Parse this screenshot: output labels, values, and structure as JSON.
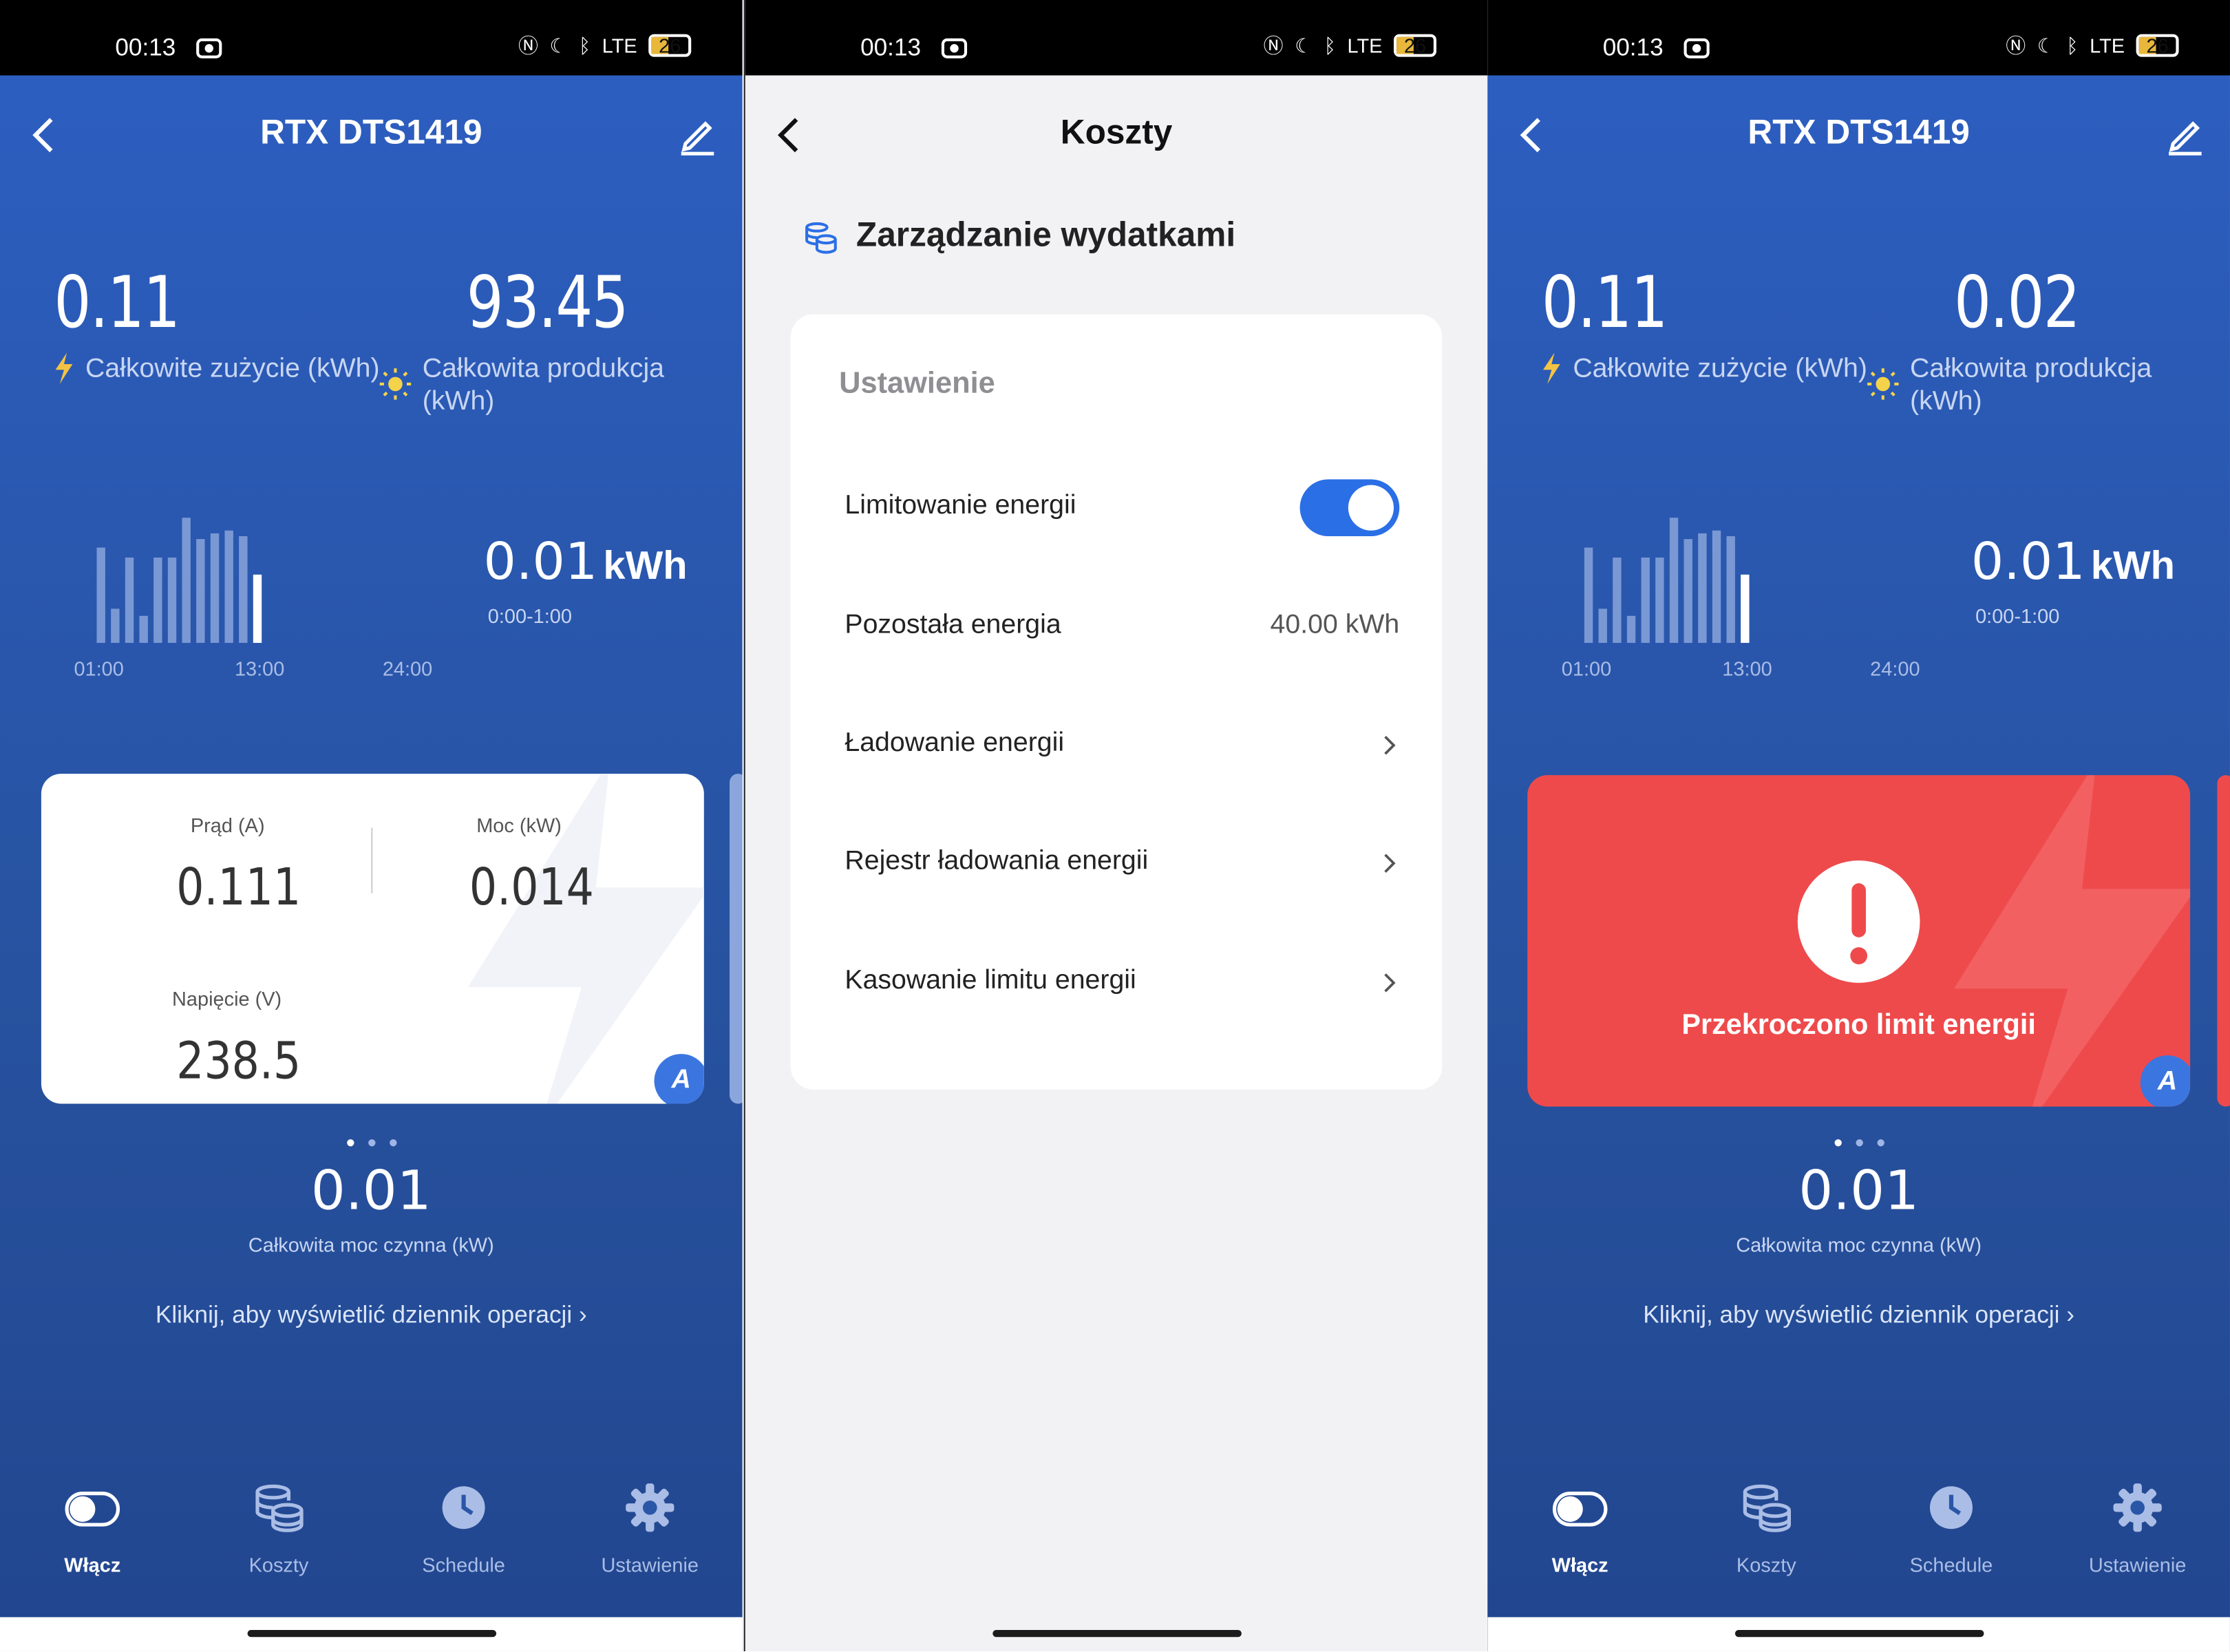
{
  "colors": {
    "blue_bg": "#2d5fc3",
    "accent": "#2b6fe6",
    "alert_red": "#ee4a4c"
  },
  "status_bar": {
    "time": "00:13",
    "network": "LTE",
    "battery": "26"
  },
  "screen1": {
    "title": "RTX DTS1419",
    "consumption": {
      "value": "0.11",
      "label": "Całkowite zużycie (kWh)"
    },
    "production": {
      "value": "93.45",
      "label": "Całkowita produkcja (kWh)"
    },
    "chart": {
      "ticks": [
        "01:00",
        "13:00",
        "24:00"
      ],
      "current_value": "0.01",
      "current_unit": "kWh",
      "current_range": "0:00-1:00",
      "bars": [
        0.7,
        0.25,
        0.62,
        0.2,
        0.62,
        0.62,
        0.92,
        0.76,
        0.8,
        0.82,
        0.78,
        0.5
      ]
    },
    "card": {
      "current_label": "Prąd (A)",
      "current_value": "0.111",
      "power_label": "Moc (kW)",
      "power_value": "0.014",
      "voltage_label": "Napięcie (V)",
      "voltage_value": "238.5",
      "badge": "A"
    },
    "total_power": {
      "value": "0.01",
      "label": "Całkowita moc czynna (kW)"
    },
    "log_link": "Kliknij, aby wyświetlić dziennik operacji"
  },
  "screen2": {
    "title": "Koszty",
    "section": "Zarządzanie wydatkami",
    "card_title": "Ustawienie",
    "rows": {
      "limit": {
        "label": "Limitowanie energii",
        "enabled": true
      },
      "remaining": {
        "label": "Pozostała energia",
        "value": "40.00 kWh"
      },
      "charging": {
        "label": "Ładowanie energii"
      },
      "history": {
        "label": "Rejestr ładowania energii"
      },
      "reset": {
        "label": "Kasowanie limitu energii"
      }
    }
  },
  "screen3": {
    "title": "RTX DTS1419",
    "consumption": {
      "value": "0.11",
      "label": "Całkowite zużycie (kWh)"
    },
    "production": {
      "value": "0.02",
      "label": "Całkowita produkcja (kWh)"
    },
    "chart": {
      "ticks": [
        "01:00",
        "13:00",
        "24:00"
      ],
      "current_value": "0.01",
      "current_unit": "kWh",
      "current_range": "0:00-1:00"
    },
    "alert": {
      "text": "Przekroczono limit energii",
      "badge": "A"
    },
    "total_power": {
      "value": "0.01",
      "label": "Całkowita moc czynna (kW)"
    },
    "log_link": "Kliknij, aby wyświetlić dziennik operacji"
  },
  "tabs": [
    {
      "label": "Włącz",
      "icon": "toggle-icon"
    },
    {
      "label": "Koszty",
      "icon": "coins-icon"
    },
    {
      "label": "Schedule",
      "icon": "clock-icon"
    },
    {
      "label": "Ustawienie",
      "icon": "gear-icon"
    }
  ]
}
